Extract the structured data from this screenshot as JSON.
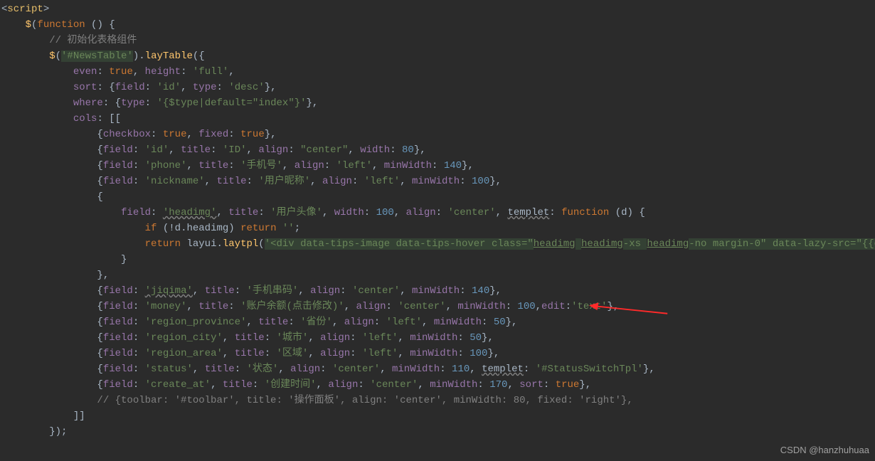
{
  "editor": {
    "language": "javascript-html",
    "theme": "darcula"
  },
  "watermark": "CSDN @hanzhuhuaa",
  "code": {
    "tag_open": "script",
    "comment_init": "// 初始化表格组件",
    "selector": "'#NewsTable'",
    "method": "layTable",
    "opt_even": "even",
    "opt_height": "height",
    "val_height": "'full'",
    "opt_sort": "sort",
    "sort_field_key": "field",
    "sort_field_val": "'id'",
    "sort_type_key": "type",
    "sort_type_val": "'desc'",
    "opt_where": "where",
    "where_type_key": "type",
    "where_type_val": "'{$type|default=\"index\"}'",
    "opt_cols": "cols",
    "cols": [
      "{checkbox: true, fixed: true},",
      "{field: 'id', title: 'ID', align: \"center\", width: 80},",
      "{field: 'phone', title: '手机号', align: 'left', minWidth: 140},",
      "{field: 'nickname', title: '用户昵称', align: 'left', minWidth: 100},"
    ],
    "headimg_field": "'headimg'",
    "headimg_title": "'用户头像'",
    "headimg_width": "100",
    "headimg_align": "'center'",
    "templet_kw": "templet",
    "fn_kw": "function",
    "fn_param": "d",
    "if_cond": "if (!d.headimg) return '';",
    "return_kw": "return",
    "layui_call": "layui.laytpl",
    "html_str_prefix": "'<div data-tips-image data-tips-hover class=\"",
    "html_classes": "headimg headimg-xs headimg-no margin-0",
    "html_str_suffix": "\" data-lazy-src=\"{{d.headimg",
    "cols_after": [
      "{field: 'jiqima', title: '手机串码', align: 'center', minWidth: 140},",
      "{field: 'money', title: '账户余额(点击修改)', align: 'center', minWidth: 100,edit:'text'},",
      "{field: 'region_province', title: '省份', align: 'left', minWidth: 50},",
      "{field: 'region_city', title: '城市', align: 'left', minWidth: 50},",
      "{field: 'region_area', title: '区域', align: 'left', minWidth: 100},",
      "{field: 'status', title: '状态', align: 'center', minWidth: 110, templet: '#StatusSwitchTpl'},",
      "{field: 'create_at', title: '创建时间', align: 'center', minWidth: 170, sort: true},",
      "// {toolbar: '#toolbar', title: '操作面板', align: 'center', minWidth: 80, fixed: 'right'},"
    ]
  }
}
